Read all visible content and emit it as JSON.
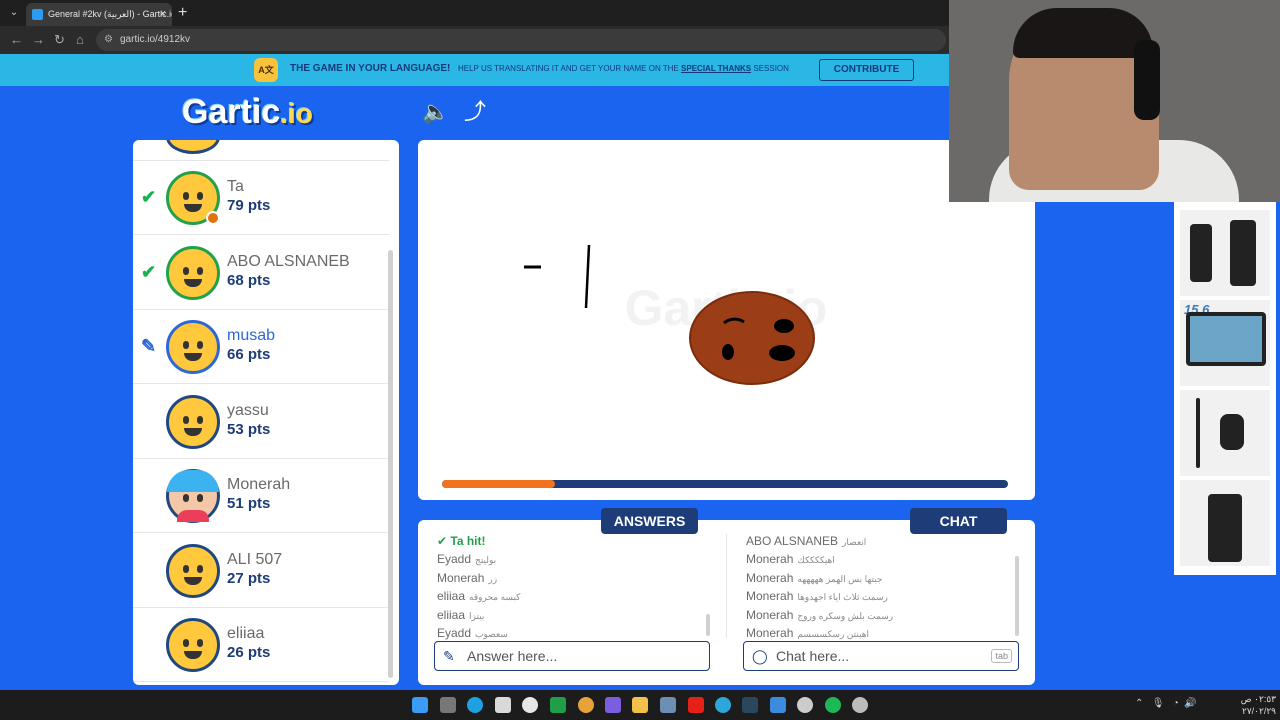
{
  "browser": {
    "tab_title": "General #2kv (العربية) - Gartic.io",
    "tab_close": "×",
    "new_tab": "+",
    "url": "gartic.io/4912kv"
  },
  "banner": {
    "headline": "THE GAME IN YOUR LANGUAGE!",
    "message_prefix": "HELP US TRANSLATING IT AND GET YOUR NAME ON THE",
    "message_highlight": "SPECIAL THANKS",
    "message_suffix": "SESSION",
    "contribute": "CONTRIBUTE"
  },
  "game": {
    "logo_main": "Gartic",
    "logo_suffix": ".io",
    "timer_progress": 0.2
  },
  "players": [
    {
      "name": "Ta",
      "points": "79 pts",
      "status": "hit"
    },
    {
      "name": "ABO ALSNANEB",
      "points": "68 pts",
      "status": "hit"
    },
    {
      "name": "musab",
      "points": "66 pts",
      "status": "drawing"
    },
    {
      "name": "yassu",
      "points": "53 pts",
      "status": "none"
    },
    {
      "name": "Monerah",
      "points": "51 pts",
      "status": "none"
    },
    {
      "name": "ALI 507",
      "points": "27 pts",
      "status": "none"
    },
    {
      "name": "eliiaa",
      "points": "26 pts",
      "status": "none"
    }
  ],
  "answers": {
    "title": "ANSWERS",
    "messages": [
      {
        "who": "Ta hit!",
        "text": ""
      },
      {
        "who": "Eyadd",
        "text": "بوليتج"
      },
      {
        "who": "Monerah",
        "text": "زر"
      },
      {
        "who": "eliiaa",
        "text": "كبسه محروقه"
      },
      {
        "who": "eliiaa",
        "text": "بيتزا"
      },
      {
        "who": "Eyadd",
        "text": "سعصوب"
      }
    ],
    "placeholder": "Answer here..."
  },
  "chat": {
    "title": "CHAT",
    "messages": [
      {
        "who": "ABO ALSNANEB",
        "text": "انعصار"
      },
      {
        "who": "Monerah",
        "text": "اهيككككك"
      },
      {
        "who": "Monerah",
        "text": "جبتها بس الهمز هههههه"
      },
      {
        "who": "Monerah",
        "text": "رسمت ثلاث اياء اجهدوها"
      },
      {
        "who": "Monerah",
        "text": "رسمت بلش وسكره وروج"
      },
      {
        "who": "Monerah",
        "text": "اهينتن رسكسسسم"
      }
    ],
    "placeholder": "Chat here...",
    "tab_hint": "tab"
  },
  "ads": {
    "monitor_size": "15.6"
  },
  "taskbar": {
    "clock_time": "٠٢:٥٣ ص",
    "clock_date": "٢٧/٠٢/٢٩"
  },
  "colors": {
    "background": "#1a64ef",
    "banner": "#2ab7e6",
    "navy": "#1d3c78",
    "hit_green": "#23a04a",
    "timer_orange": "#f0731e",
    "drawing_brown": "#9b3d16"
  }
}
